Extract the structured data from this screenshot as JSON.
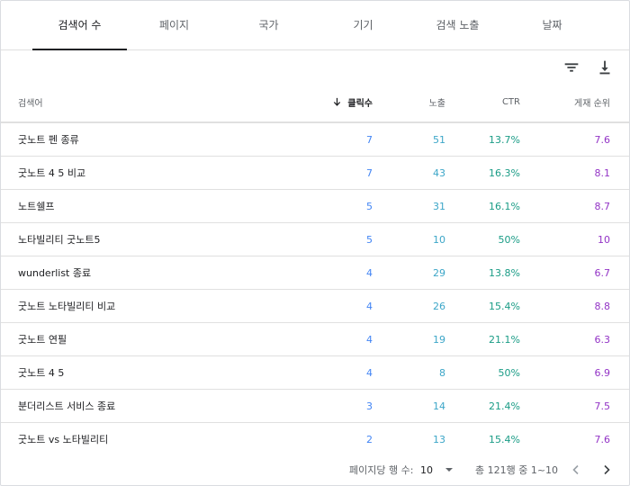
{
  "tabs": [
    {
      "label": "검색어 수",
      "active": true
    },
    {
      "label": "페이지",
      "active": false
    },
    {
      "label": "국가",
      "active": false
    },
    {
      "label": "기기",
      "active": false
    },
    {
      "label": "검색 노출",
      "active": false
    },
    {
      "label": "날짜",
      "active": false
    }
  ],
  "toolbar": {
    "filter_icon": "filter-icon",
    "download_icon": "download-icon"
  },
  "table": {
    "headers": {
      "query": "검색어",
      "clicks": "클릭수",
      "impressions": "노출",
      "ctr": "CTR",
      "position": "게재 순위"
    },
    "sort_icon": "arrow-down-icon",
    "rows": [
      {
        "query": "굿노트 펜 종류",
        "clicks": "7",
        "impressions": "51",
        "ctr": "13.7%",
        "position": "7.6"
      },
      {
        "query": "굿노트 4 5 비교",
        "clicks": "7",
        "impressions": "43",
        "ctr": "16.3%",
        "position": "8.1"
      },
      {
        "query": "노트쉘프",
        "clicks": "5",
        "impressions": "31",
        "ctr": "16.1%",
        "position": "8.7"
      },
      {
        "query": "노타빌리티 굿노트5",
        "clicks": "5",
        "impressions": "10",
        "ctr": "50%",
        "position": "10"
      },
      {
        "query": "wunderlist 종료",
        "clicks": "4",
        "impressions": "29",
        "ctr": "13.8%",
        "position": "6.7"
      },
      {
        "query": "굿노트 노타빌리티 비교",
        "clicks": "4",
        "impressions": "26",
        "ctr": "15.4%",
        "position": "8.8"
      },
      {
        "query": "굿노트 연필",
        "clicks": "4",
        "impressions": "19",
        "ctr": "21.1%",
        "position": "6.3"
      },
      {
        "query": "굿노트 4 5",
        "clicks": "4",
        "impressions": "8",
        "ctr": "50%",
        "position": "6.9"
      },
      {
        "query": "분더리스트 서비스 종료",
        "clicks": "3",
        "impressions": "14",
        "ctr": "21.4%",
        "position": "7.5"
      },
      {
        "query": "굿노트 vs 노타빌리티",
        "clicks": "2",
        "impressions": "13",
        "ctr": "15.4%",
        "position": "7.6"
      }
    ]
  },
  "pagination": {
    "rows_per_page_label": "페이지당 행 수:",
    "rows_per_page_value": "10",
    "range_text": "총 121행 중 1~10",
    "prev_icon": "chevron-left-icon",
    "next_icon": "chevron-right-icon"
  },
  "colors": {
    "clicks": "#4285f4",
    "impressions": "#3ca6c8",
    "ctr": "#1a9c86",
    "position": "#9334c6"
  }
}
